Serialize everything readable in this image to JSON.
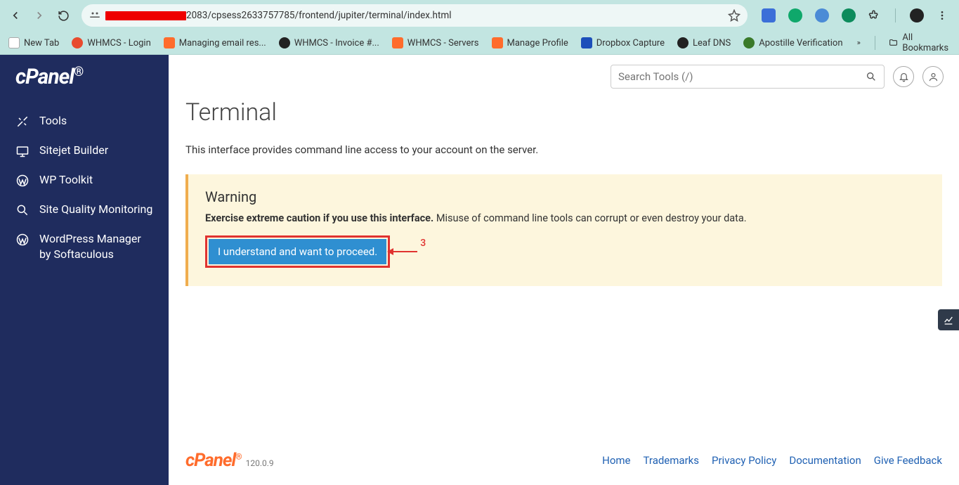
{
  "browser": {
    "url_visible": "2083/cpsess2633757785/frontend/jupiter/terminal/index.html",
    "bookmarks": [
      {
        "label": "New Tab",
        "color": "#555"
      },
      {
        "label": "WHMCS - Login",
        "color": "#e84b2e"
      },
      {
        "label": "Managing email res...",
        "color": "#ff6c2c"
      },
      {
        "label": "WHMCS - Invoice #...",
        "color": "#222"
      },
      {
        "label": "WHMCS - Servers",
        "color": "#ff6c2c"
      },
      {
        "label": "Manage Profile",
        "color": "#ff6c2c"
      },
      {
        "label": "Dropbox Capture",
        "color": "#1c4fba"
      },
      {
        "label": "Leaf DNS",
        "color": "#222"
      },
      {
        "label": "Apostille Verification",
        "color": "#3a7a2a"
      }
    ],
    "all_bookmarks": "All Bookmarks"
  },
  "sidebar": {
    "logo": "cPanel",
    "items": [
      {
        "label": "Tools"
      },
      {
        "label": "Sitejet Builder"
      },
      {
        "label": "WP Toolkit"
      },
      {
        "label": "Site Quality Monitoring"
      },
      {
        "label": "WordPress Manager by Softaculous"
      }
    ]
  },
  "topbar": {
    "search_placeholder": "Search Tools (/)"
  },
  "page": {
    "title": "Terminal",
    "description": "This interface provides command line access to your account on the server.",
    "warning": {
      "heading": "Warning",
      "bold": "Exercise extreme caution if you use this interface.",
      "rest": " Misuse of command line tools can corrupt or even destroy your data.",
      "button": "I understand and want to proceed."
    },
    "annotation_number": "3"
  },
  "footer": {
    "logo": "cPanel",
    "version": "120.0.9",
    "links": [
      "Home",
      "Trademarks",
      "Privacy Policy",
      "Documentation",
      "Give Feedback"
    ]
  }
}
